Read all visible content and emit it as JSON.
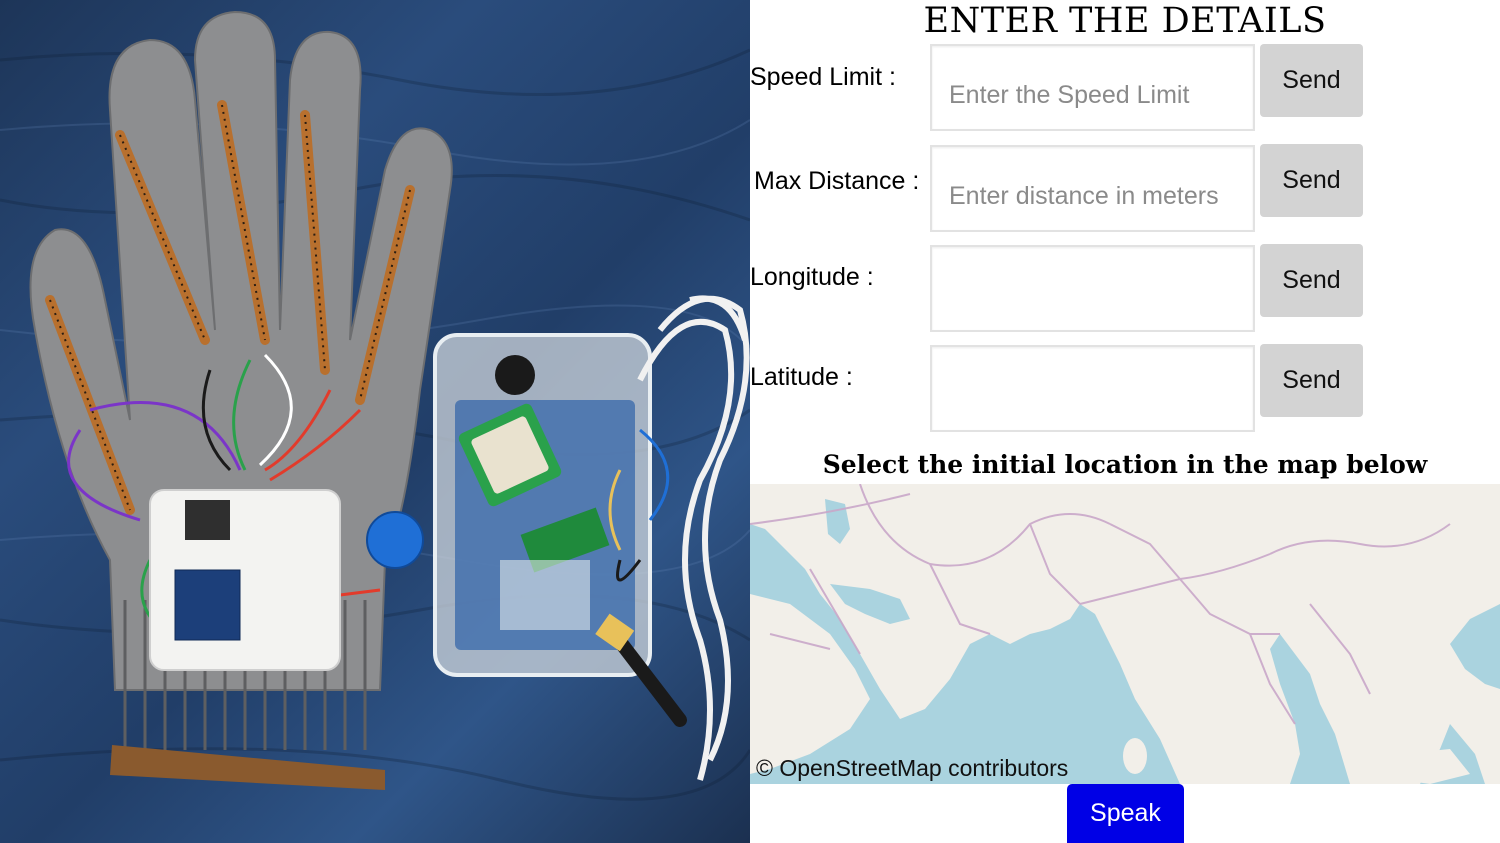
{
  "photo": {
    "description_icon": "smart-glove-prototype"
  },
  "form": {
    "heading": "ENTER THE DETAILS",
    "rows": [
      {
        "label": "Speed Limit :",
        "placeholder": "Enter the Speed Limit",
        "value": "",
        "button": "Send"
      },
      {
        "label": "Max Distance :",
        "placeholder": "Enter distance in meters",
        "value": "",
        "button": "Send"
      },
      {
        "label": "Longitude :",
        "placeholder": "",
        "value": "",
        "button": "Send"
      },
      {
        "label": "Latitude :",
        "placeholder": "",
        "value": "",
        "button": "Send"
      }
    ],
    "map_title": "Select the initial location in the map below",
    "map_attribution": "© OpenStreetMap contributors",
    "speak_button": "Speak"
  },
  "colors": {
    "send_button": "#d3d3d3",
    "speak_button": "#0000e6",
    "map_water": "#aad3df",
    "map_land": "#f2efe9",
    "map_border": "#c9a8c9"
  }
}
